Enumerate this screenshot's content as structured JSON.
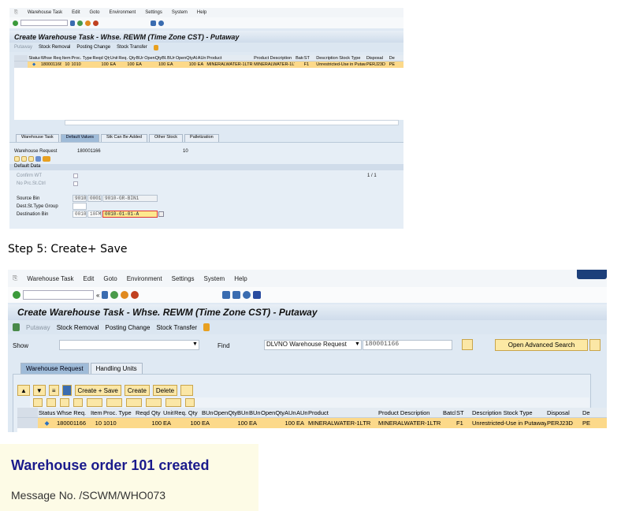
{
  "shot1": {
    "menu": [
      "Warehouse Task",
      "Edit",
      "Goto",
      "Environment",
      "Settings",
      "System",
      "Help"
    ],
    "title": "Create Warehouse Task - Whse. REWM (Time Zone CST) - Putaway",
    "app_toolbar": [
      "Putaway",
      "Stock Removal",
      "Posting Change",
      "Stock Transfer"
    ],
    "tabs": [
      "Warehouse Task",
      "Default Values",
      "Stk Can Be Added",
      "Other Stock",
      "Palletization"
    ],
    "active_tab": "Default Values",
    "warehouse_request_label": "Warehouse Request",
    "warehouse_request_value": "180001166",
    "item_value": "10",
    "default_data_label": "Default Data",
    "confirm_wt_label": "Confirm WT",
    "no_prc_label": "No Prc.St.Ctrl",
    "page_counter": "1  / 1",
    "source_bin_label": "Source Bin",
    "source_bin": [
      "9010",
      "0001",
      "9010-GR-BIN1"
    ],
    "dest_group_label": "Dest.St.Type Group",
    "dest_bin_label": "Destination Bin",
    "dest_bin": [
      "0010",
      "10FM",
      "0010-01-01-A"
    ]
  },
  "step_caption": "Step 5: Create+ Save",
  "shot2": {
    "menu": [
      "Warehouse Task",
      "Edit",
      "Goto",
      "Environment",
      "Settings",
      "System",
      "Help"
    ],
    "title": "Create Warehouse Task - Whse. REWM (Time Zone CST) - Putaway",
    "app_toolbar": [
      "Putaway",
      "Stock Removal",
      "Posting Change",
      "Stock Transfer"
    ],
    "show_label": "Show",
    "show_value": "",
    "find_label": "Find",
    "find_type": "DLVNO Warehouse Request",
    "find_value": "180001166",
    "advanced_search": "Open Advanced Search",
    "tabs": [
      "Warehouse Request",
      "Handling Units"
    ],
    "active_tab": "Warehouse Request",
    "buttons": [
      "Create + Save",
      "Create",
      "Delete"
    ]
  },
  "table": {
    "columns": [
      "Status",
      "Whse Req.",
      "Item",
      "Proc. Type",
      "Reqd Qty",
      "Unit",
      "Req. Qty",
      "BUn",
      "OpenQtyBUn",
      "BUn",
      "OpenQtyAUn",
      "AUn",
      "Product",
      "Product Description",
      "Batch",
      "ST",
      "Description Stock Type",
      "Disposal",
      "De"
    ],
    "rows": [
      [
        "◆",
        "180001166",
        "10",
        "1010",
        "100",
        "EA",
        "100",
        "EA",
        "100",
        "EA",
        "100",
        "EA",
        "MINERALWATER-1LTR",
        "MINERALWATER-1LTR",
        "",
        "F1",
        "Unrestricted-Use in Putaway",
        "PERJ23D",
        "PE"
      ]
    ]
  },
  "message": {
    "title": "Warehouse order 101 created",
    "number": "Message No. /SCWM/WHO073"
  },
  "colors": {
    "selected_row": "#fcd98a",
    "message_title": "#1a1a8c",
    "message_bg": "#fdfbe6"
  }
}
